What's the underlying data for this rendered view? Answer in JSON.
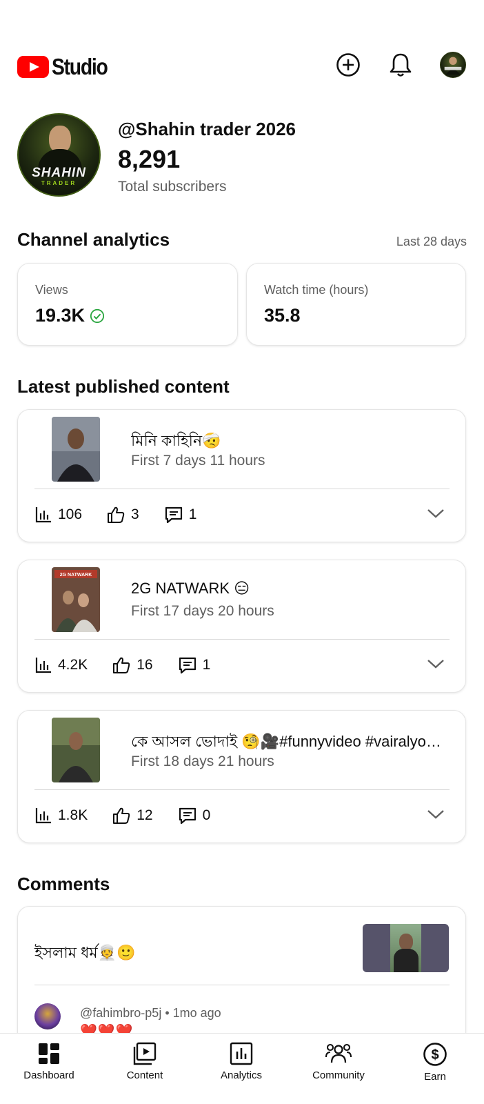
{
  "header": {
    "app_name": "Studio",
    "icons": [
      "create-icon",
      "notifications-icon",
      "account-avatar"
    ]
  },
  "channel": {
    "handle": "@Shahin trader 2026",
    "subscriber_count": "8,291",
    "subscriber_label": "Total subscribers",
    "avatar_text": "SHAHIN",
    "avatar_subtext": "TRADER"
  },
  "analytics": {
    "title": "Channel analytics",
    "period": "Last 28 days",
    "metrics": [
      {
        "label": "Views",
        "value": "19.3K",
        "verified": true
      },
      {
        "label": "Watch time (hours)",
        "value": "35.8",
        "verified": false
      }
    ]
  },
  "latest": {
    "title": "Latest published content",
    "items": [
      {
        "title": "মিনি কাহিনি🤕",
        "subtitle": "First 7 days 11 hours",
        "views": "106",
        "likes": "3",
        "comments": "1"
      },
      {
        "title": "2G NATWARK 😑",
        "subtitle": "First 17 days 20 hours",
        "views": "4.2K",
        "likes": "16",
        "comments": "1"
      },
      {
        "title": "কে আসল ভোদাই 🧐🎥#funnyvideo #vairalyo…",
        "subtitle": "First 18 days 21 hours",
        "views": "1.8K",
        "likes": "12",
        "comments": "0"
      }
    ]
  },
  "comments": {
    "title": "Comments",
    "first": {
      "text": "ইসলাম ধর্ম👳🙂",
      "author_meta": "@fahimbro-p5j • 1mo ago",
      "reply_preview": "❤️❤️❤️"
    }
  },
  "bottom_nav": [
    {
      "label": "Dashboard",
      "icon": "dashboard-icon"
    },
    {
      "label": "Content",
      "icon": "content-icon"
    },
    {
      "label": "Analytics",
      "icon": "analytics-icon"
    },
    {
      "label": "Community",
      "icon": "community-icon"
    },
    {
      "label": "Earn",
      "icon": "earn-icon"
    }
  ],
  "colors": {
    "brand_red": "#ff0000",
    "success_green": "#2ba640",
    "secondary_text": "#606060"
  }
}
